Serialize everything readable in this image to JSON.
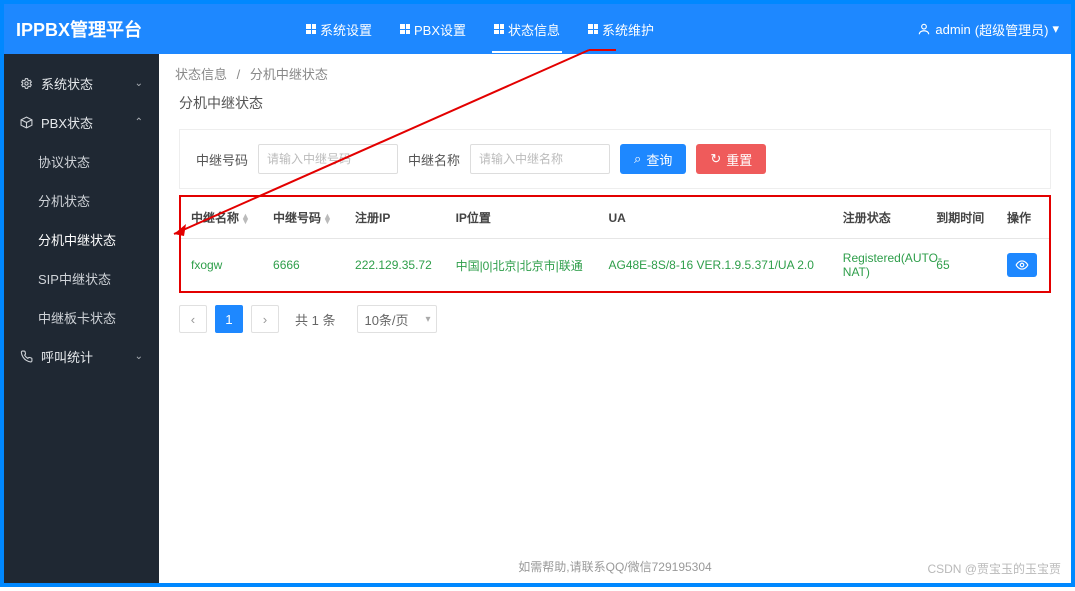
{
  "app": {
    "title": "IPPBX管理平台"
  },
  "topnav": [
    {
      "label": "系统设置"
    },
    {
      "label": "PBX设置"
    },
    {
      "label": "状态信息",
      "active": true
    },
    {
      "label": "系统维护"
    }
  ],
  "user": {
    "name": "admin",
    "role_wrapped": "(超级管理员)",
    "menu_glyph": "▾"
  },
  "sidebar": {
    "groups": [
      {
        "label": "系统状态",
        "expanded": false
      },
      {
        "label": "PBX状态",
        "expanded": true,
        "items": [
          {
            "label": "协议状态"
          },
          {
            "label": "分机状态"
          },
          {
            "label": "分机中继状态",
            "active": true
          },
          {
            "label": "SIP中继状态"
          },
          {
            "label": "中继板卡状态"
          }
        ]
      },
      {
        "label": "呼叫统计",
        "expanded": false
      }
    ]
  },
  "breadcrumb": {
    "a": "状态信息",
    "b": "分机中继状态",
    "sep": "/"
  },
  "panel": {
    "title": "分机中继状态"
  },
  "filter": {
    "trunk_no_label": "中继号码",
    "trunk_no_placeholder": "请输入中继号码",
    "trunk_name_label": "中继名称",
    "trunk_name_placeholder": "请输入中继名称",
    "search_label": "查询",
    "reset_label": "重置"
  },
  "table": {
    "columns": {
      "name": "中继名称",
      "number": "中继号码",
      "reg_ip": "注册IP",
      "ip_loc": "IP位置",
      "ua": "UA",
      "reg_state": "注册状态",
      "expire": "到期时间",
      "action": "操作"
    },
    "rows": [
      {
        "name": "fxogw",
        "number": "6666",
        "reg_ip": "222.129.35.72",
        "ip_loc": "中国|0|北京|北京市|联通",
        "ua": "AG48E-8S/8-16 VER.1.9.5.371/UA 2.0",
        "reg_state": "Registered(AUTO-NAT)",
        "expire": "65"
      }
    ]
  },
  "pagination": {
    "prev_glyph": "‹",
    "next_glyph": "›",
    "current": "1",
    "total_text": "共 1 条",
    "page_size_label": "10条/页",
    "page_size_caret": "▾"
  },
  "footer": {
    "text": "如需帮助,请联系QQ/微信729195304"
  },
  "watermark": {
    "text": "CSDN @贾宝玉的玉宝贾"
  },
  "icons": {
    "search_glyph": "⌕",
    "reset_glyph": "↻"
  }
}
